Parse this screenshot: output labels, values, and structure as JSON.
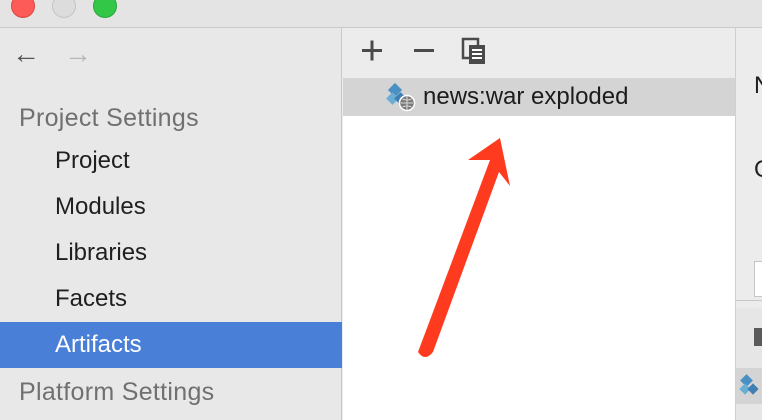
{
  "window": {
    "traffic_lights": [
      "close",
      "minimize",
      "zoom"
    ]
  },
  "navigation": {
    "back_glyph": "←",
    "forward_glyph": "→"
  },
  "sidebar": {
    "project_settings_header": "Project Settings",
    "items": [
      {
        "label": "Project",
        "selected": false
      },
      {
        "label": "Modules",
        "selected": false
      },
      {
        "label": "Libraries",
        "selected": false
      },
      {
        "label": "Facets",
        "selected": false
      },
      {
        "label": "Artifacts",
        "selected": true
      }
    ],
    "platform_settings_header": "Platform Settings"
  },
  "toolbar": {
    "buttons": [
      "plus-icon",
      "minus-icon",
      "copy-icon"
    ]
  },
  "artifacts": {
    "items": [
      {
        "label": "news:war exploded",
        "icon": "web-artifact-icon",
        "selected": true
      }
    ]
  },
  "right_panel": {
    "letter_1": "N",
    "letter_2": "O"
  },
  "colors": {
    "selection": "#4a7fd8",
    "annotation_arrow": "#ff3b1f"
  }
}
